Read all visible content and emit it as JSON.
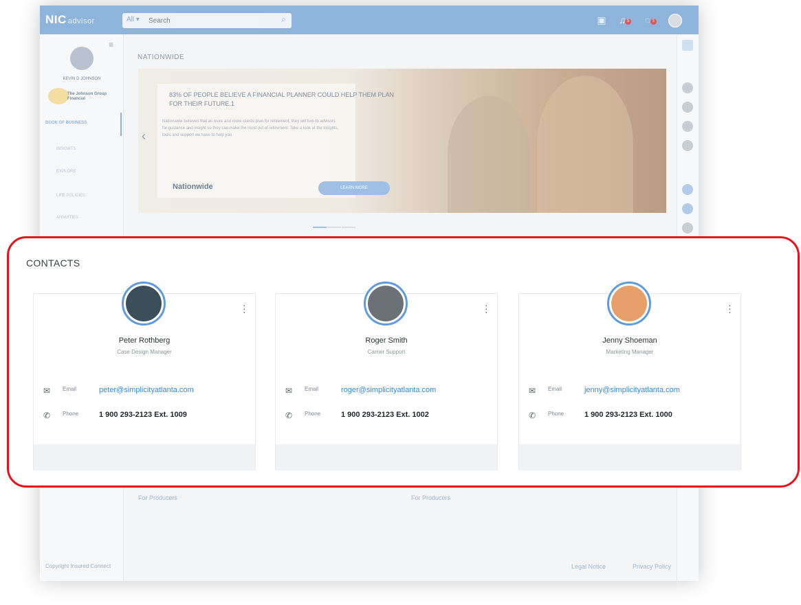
{
  "app": {
    "logo": "NIC",
    "logo_sub": "advisor",
    "search_scope": "All",
    "search_placeholder": "Search",
    "notification_count_1": "5",
    "notification_count_2": "5"
  },
  "sidebar": {
    "user_name": "KEVIN D JOHNSON",
    "company": "The Johnson Group Financial",
    "items": [
      {
        "label": "BOOK OF BUSINESS"
      },
      {
        "label": "INSIGHTS"
      },
      {
        "label": "EXPLORE"
      },
      {
        "label": "LIFE POLICIES"
      },
      {
        "label": "ANNUITIES"
      }
    ]
  },
  "main": {
    "title": "NATIONWIDE",
    "banner": {
      "heading": "83% OF PEOPLE BELIEVE A FINANCIAL PLANNER COULD HELP THEM PLAN FOR THEIR FUTURE.1",
      "text": "Nationwide believes that as more and more clients plan for retirement, they will turn to advisors for guidance and insight so they can make the most out of retirement. Take a look at the insights, tools and support we have to help you.",
      "brand": "Nationwide",
      "cta": "LEARN MORE"
    },
    "producers_link_1": "For Producers",
    "producers_link_2": "For Producers"
  },
  "footer": {
    "copyright": "Copyright Insured Connect",
    "legal": "Legal Notice",
    "privacy": "Privacy Policy"
  },
  "contacts": {
    "title": "CONTACTS",
    "email_label": "Email",
    "phone_label": "Phone",
    "items": [
      {
        "name": "Peter Rothberg",
        "role": "Case Design Manager",
        "email": "peter@simplicityatlanta.com",
        "phone": "1 900 293-2123  Ext. 1009",
        "avatar_color": "#3a4f5a"
      },
      {
        "name": "Roger Smith",
        "role": "Carrier Support",
        "email": "roger@simplicityatlanta.com",
        "phone": "1 900 293-2123  Ext. 1002",
        "avatar_color": "#6b7177"
      },
      {
        "name": "Jenny Shoeman",
        "role": "Marketing Manager",
        "email": "jenny@simplicityatlanta.com",
        "phone": "1 900 293-2123  Ext. 1000",
        "avatar_color": "#e7a06a"
      }
    ]
  },
  "colors": {
    "highlight": "#e8101a",
    "accent": "#2d8ae3",
    "header": "#8fb4dc"
  }
}
